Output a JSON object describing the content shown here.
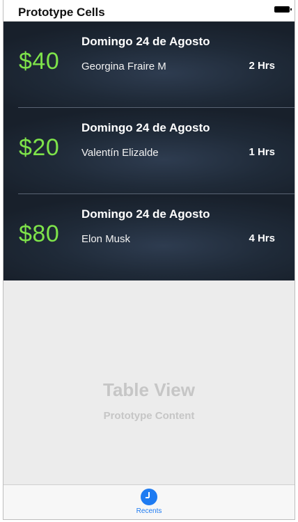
{
  "header": {
    "title": "Prototype Cells",
    "battery_icon": "battery-icon"
  },
  "cells": [
    {
      "amount": "$40",
      "date": "Domingo 24 de Agosto",
      "name": "Georgina Fraire M",
      "hours": "2 Hrs"
    },
    {
      "amount": "$20",
      "date": "Domingo 24 de Agosto",
      "name": "Valentín Elizalde",
      "hours": "1 Hrs"
    },
    {
      "amount": "$80",
      "date": "Domingo 24 de Agosto",
      "name": "Elon Musk",
      "hours": "4 Hrs"
    }
  ],
  "placeholder": {
    "title": "Table View",
    "subtitle": "Prototype Content"
  },
  "tabbar": {
    "tabs": [
      {
        "label": "Recents",
        "icon": "clock-icon",
        "selected": true
      }
    ]
  },
  "colors": {
    "amount": "#7ee34a",
    "cell_background": "#1f2a38",
    "accent": "#1e7bf2",
    "placeholder_text": "#c6c6c6"
  }
}
